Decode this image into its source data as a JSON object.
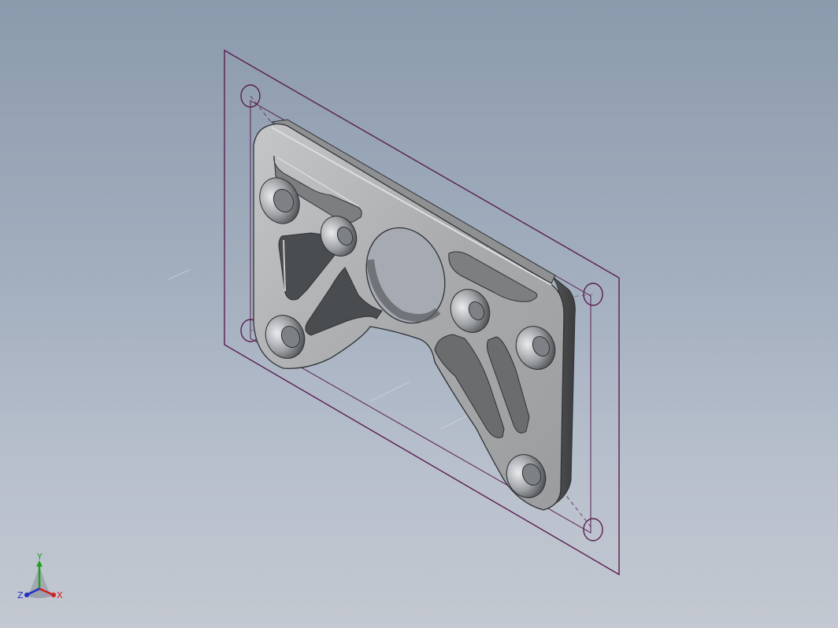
{
  "viewport": {
    "background_top": "#8b9aac",
    "background_bottom": "#c3c8d1"
  },
  "sketch": {
    "color": "#5a1e52"
  },
  "part": {
    "face_color": "#a9abad",
    "edge_color": "#2f3235"
  },
  "triad": {
    "x_label": "X",
    "y_label": "Y",
    "z_label": "Z",
    "x_color": "#d02020",
    "y_color": "#20a020",
    "z_color": "#2030c0"
  }
}
